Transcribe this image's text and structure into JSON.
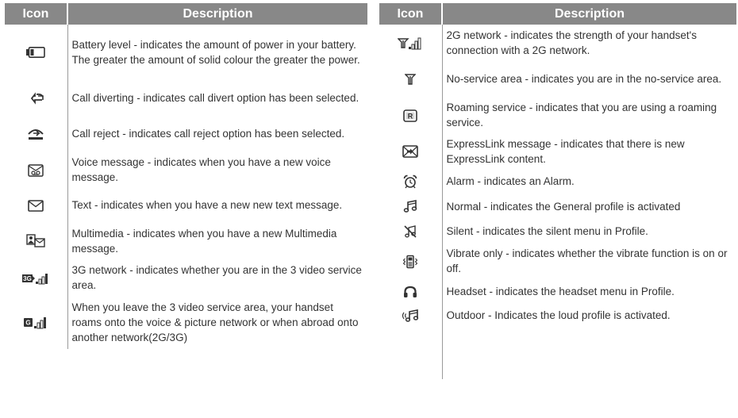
{
  "headers": {
    "icon": "Icon",
    "description": "Description"
  },
  "left_rows": [
    {
      "icon": "battery-icon",
      "text": "Battery level - indicates the amount of power in your battery. The greater the amount of solid colour the greater the power."
    },
    {
      "icon": "call-divert-icon",
      "text": "Call diverting - indicates call divert option has been selected."
    },
    {
      "icon": "call-reject-icon",
      "text": "Call reject - indicates call reject option has been selected."
    },
    {
      "icon": "voice-message-icon",
      "text": "Voice message - indicates when you have a new voice message."
    },
    {
      "icon": "text-message-icon",
      "text": "Text - indicates when you have a new new text message."
    },
    {
      "icon": "multimedia-message-icon",
      "text": "Multimedia - indicates when you have a new Multimedia message."
    },
    {
      "icon": "3g-network-icon",
      "text": "3G network - indicates whether you are in the 3 video service area."
    },
    {
      "icon": "roaming-network-icon",
      "text": "When you leave the 3 video service area, your handset roams onto the voice & picture network or when abroad onto another network(2G/3G)"
    }
  ],
  "right_rows": [
    {
      "icon": "2g-network-icon",
      "text": "2G network - indicates the strength of your handset's connection with a 2G network."
    },
    {
      "icon": "no-service-icon",
      "text": "No-service area - indicates you are in the no-service area."
    },
    {
      "icon": "roaming-service-icon",
      "text": "Roaming service - indicates that you are using a roaming service."
    },
    {
      "icon": "expresslink-icon",
      "text": "ExpressLink message - indicates that there is new ExpressLink content."
    },
    {
      "icon": "alarm-icon",
      "text": "Alarm - indicates an Alarm."
    },
    {
      "icon": "normal-profile-icon",
      "text": "Normal - indicates the General profile is activated"
    },
    {
      "icon": "silent-icon",
      "text": "Silent - indicates the silent menu in Profile."
    },
    {
      "icon": "vibrate-icon",
      "text": "Vibrate only - indicates whether the vibrate function is on or off."
    },
    {
      "icon": "headset-icon",
      "text": "Headset - indicates the headset menu in Profile."
    },
    {
      "icon": "outdoor-profile-icon",
      "text": "Outdoor - Indicates the loud profile is activated."
    }
  ],
  "colors": {
    "header_bg": "#888888",
    "header_text": "#ffffff",
    "body_text": "#333333",
    "divider": "#9a9a9a"
  }
}
